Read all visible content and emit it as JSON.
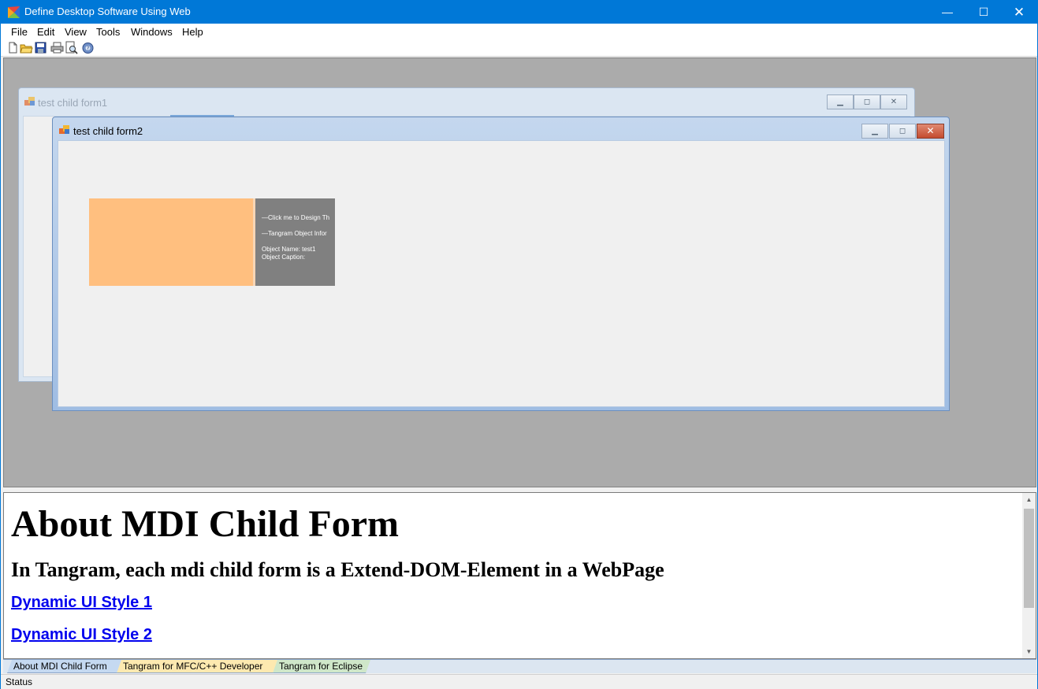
{
  "window": {
    "title": "Define Desktop Software Using Web",
    "minimize_glyph": "—",
    "maximize_glyph": "☐",
    "close_glyph": "✕",
    "accent": "#0078d7"
  },
  "menu": {
    "items": [
      "File",
      "Edit",
      "View",
      "Tools",
      "Windows",
      "Help"
    ]
  },
  "toolbar": {
    "buttons": [
      "new-icon",
      "open-icon",
      "save-icon",
      "print-icon",
      "print-preview-icon",
      "about-icon"
    ]
  },
  "mdi": {
    "background": "#ababab",
    "child1": {
      "title": "test child form1",
      "active": false
    },
    "child2": {
      "title": "test child form2",
      "active": true,
      "panel": {
        "line1": "—Click me to Design Th",
        "line2": "—Tangram Object Infor",
        "line3": "Object Name:  test1",
        "line4": "Object Caption:"
      },
      "colors": {
        "orange_panel": "#ffbf7f",
        "gray_panel": "#808080"
      }
    }
  },
  "web": {
    "heading": "About MDI Child Form",
    "subheading": "In Tangram, each mdi child form is a Extend-DOM-Element in a WebPage",
    "links": [
      "Dynamic UI Style 1",
      "Dynamic UI Style 2"
    ]
  },
  "tabs": [
    "About MDI Child Form",
    "Tangram for MFC/C++ Developer",
    "Tangram for Eclipse"
  ],
  "status": {
    "text": "Status"
  }
}
